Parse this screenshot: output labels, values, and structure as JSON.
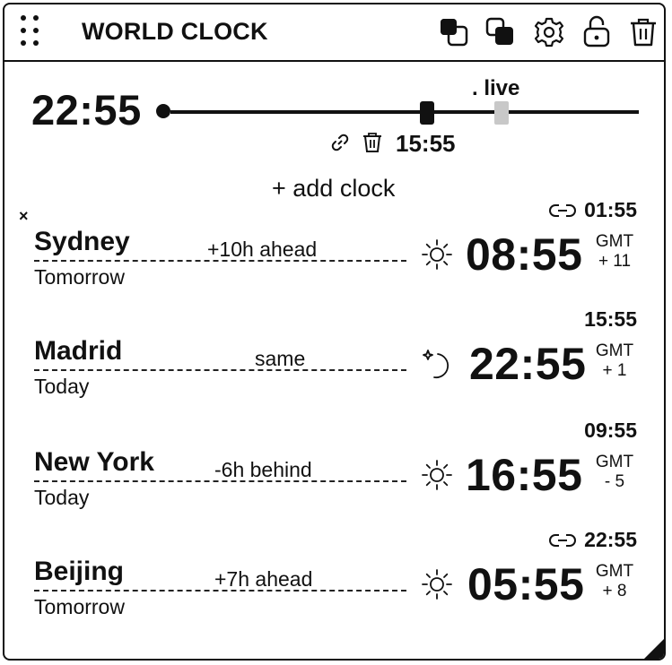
{
  "header": {
    "title": "WORLD CLOCK",
    "icons": [
      "drag-grip-icon",
      "dark-mode-icon",
      "light-mode-icon",
      "gear-icon",
      "lock-open-icon",
      "trash-icon"
    ]
  },
  "timeline": {
    "current_time": "22:55",
    "live_label": ". live",
    "selected_time": "15:55"
  },
  "add_clock_label": "+ add clock",
  "remove_label": "×",
  "clocks": [
    {
      "city": "Sydney",
      "day": "Tomorrow",
      "diff": "+10h ahead",
      "time": "08:55",
      "gmt_label": "GMT",
      "gmt_offset": "+ 11",
      "sky_icon": "sun-icon",
      "selected_time": "01:55",
      "linked": true
    },
    {
      "city": "Madrid",
      "day": "Today",
      "diff": "same",
      "time": "22:55",
      "gmt_label": "GMT",
      "gmt_offset": "+ 1",
      "sky_icon": "moon-icon",
      "selected_time": "15:55",
      "linked": false
    },
    {
      "city": "New York",
      "day": "Today",
      "diff": "-6h behind",
      "time": "16:55",
      "gmt_label": "GMT",
      "gmt_offset": "- 5",
      "sky_icon": "sun-icon",
      "selected_time": "09:55",
      "linked": false
    },
    {
      "city": "Beijing",
      "day": "Tomorrow",
      "diff": "+7h ahead",
      "time": "05:55",
      "gmt_label": "GMT",
      "gmt_offset": "+ 8",
      "sky_icon": "sun-icon",
      "selected_time": "22:55",
      "linked": true
    }
  ],
  "colors": {
    "ink": "#111111",
    "live_handle": "#c8c8c8",
    "background": "#ffffff"
  }
}
